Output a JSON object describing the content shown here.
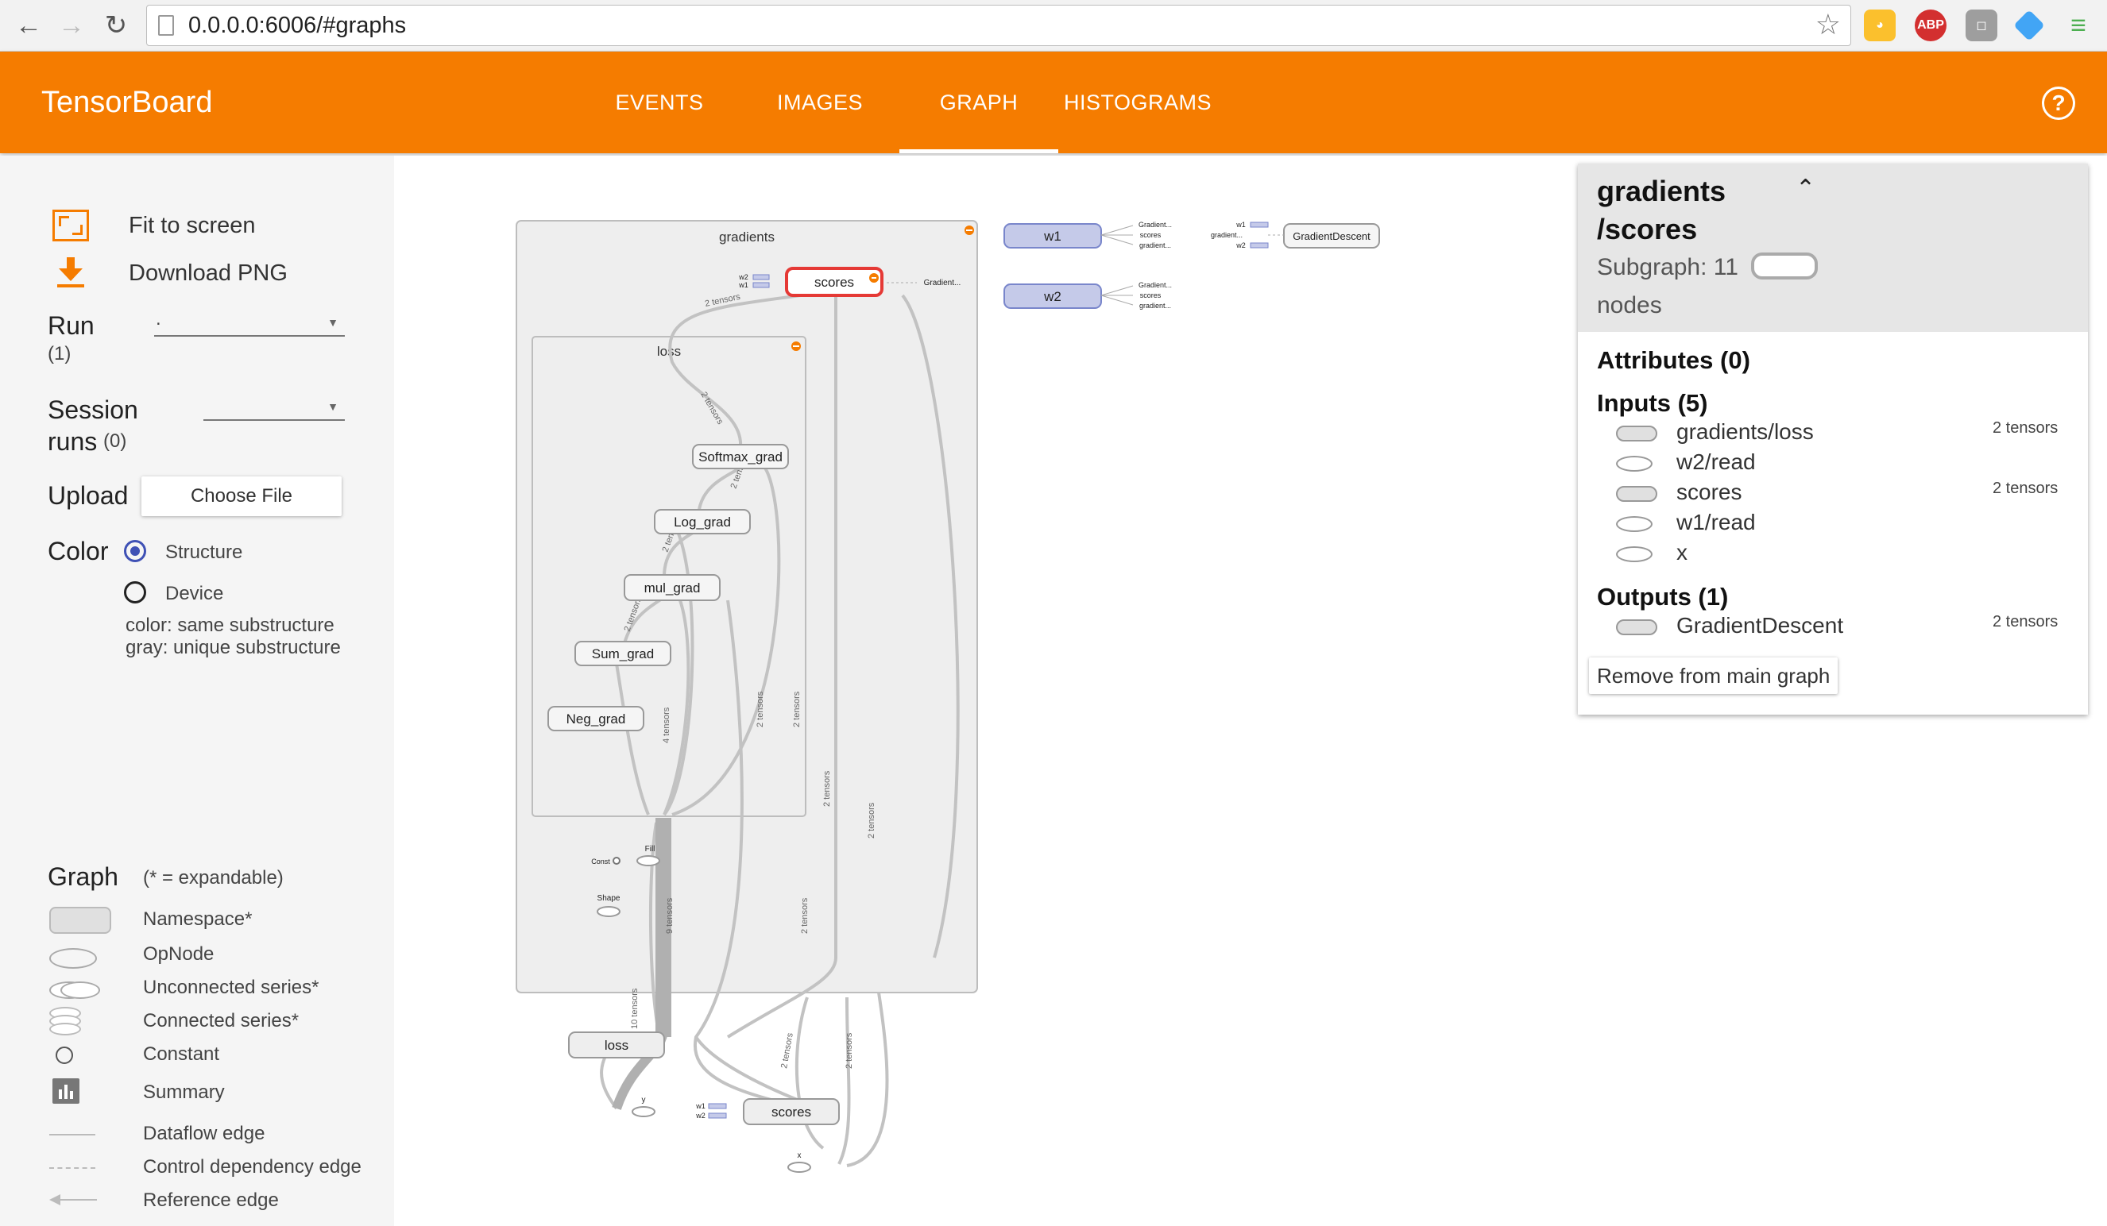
{
  "browser": {
    "url": "0.0.0.0:6006/#graphs",
    "extensions": [
      "color-picker-icon",
      "adblock-icon",
      "ghostery-icon",
      "bookmark-icon",
      "menu-icon"
    ],
    "adblock_label": "ABP"
  },
  "header": {
    "brand": "TensorBoard",
    "tabs": [
      "EVENTS",
      "IMAGES",
      "GRAPH",
      "HISTOGRAMS"
    ],
    "active_tab": "GRAPH",
    "help_symbol": "?"
  },
  "controls": {
    "fit_to_screen": "Fit to screen",
    "download_png": "Download PNG",
    "run_label": "Run",
    "run_count": "(1)",
    "run_value": ".",
    "session_label_1": "Session",
    "session_label_2": "runs",
    "session_count": "(0)",
    "session_value": "",
    "upload_label": "Upload",
    "choose_file": "Choose File",
    "color_label": "Color",
    "color_options": [
      "Structure",
      "Device"
    ],
    "color_selected": "Structure",
    "color_note_1": "color: same substructure",
    "color_note_2": "gray: unique substructure"
  },
  "legend": {
    "title": "Graph",
    "subtitle": "(* = expandable)",
    "items": [
      "Namespace*",
      "OpNode",
      "Unconnected series*",
      "Connected series*",
      "Constant",
      "Summary",
      "Dataflow edge",
      "Control dependency edge",
      "Reference edge"
    ]
  },
  "graph": {
    "gradients_label": "gradients",
    "loss_inner_label": "loss",
    "nodes": {
      "scores_sel": "scores",
      "softmax": "Softmax_grad",
      "log": "Log_grad",
      "mul": "mul_grad",
      "sum": "Sum_grad",
      "neg": "Neg_grad",
      "fill": "Fill",
      "const": "Const",
      "shape": "Shape",
      "loss": "loss",
      "scores": "scores",
      "y": "y",
      "x": "x",
      "w1": "w1",
      "w2": "w2",
      "gd": "GradientDescent"
    },
    "edge_labels": {
      "two_tensors": "2 tensors",
      "four_tensors": "4 tensors",
      "nine_tensors": "9 tensors",
      "ten_tensors": "10 tensors"
    },
    "aux_labels": [
      "Gradient...",
      "scores",
      "gradient...",
      "gradient...",
      "w1",
      "w2"
    ]
  },
  "info": {
    "title_1": "gradients",
    "title_2": "/scores",
    "subgraph": "Subgraph: 11",
    "nodes_word": "nodes",
    "attributes": "Attributes (0)",
    "inputs_title": "Inputs (5)",
    "inputs": [
      {
        "name": "gradients/loss",
        "tensors": "2 tensors",
        "shape": "pill"
      },
      {
        "name": "w2/read",
        "tensors": "",
        "shape": "oval"
      },
      {
        "name": "scores",
        "tensors": "2 tensors",
        "shape": "pill"
      },
      {
        "name": "w1/read",
        "tensors": "",
        "shape": "oval"
      },
      {
        "name": "x",
        "tensors": "",
        "shape": "oval"
      }
    ],
    "outputs_title": "Outputs (1)",
    "outputs": [
      {
        "name": "GradientDescent",
        "tensors": "2 tensors",
        "shape": "pill"
      }
    ],
    "remove_button": "Remove from main graph"
  },
  "colors": {
    "header": "#f57c00",
    "selected_node": "#e53935",
    "radio": "#3f51b5",
    "variable_node": "#c5cae9"
  }
}
